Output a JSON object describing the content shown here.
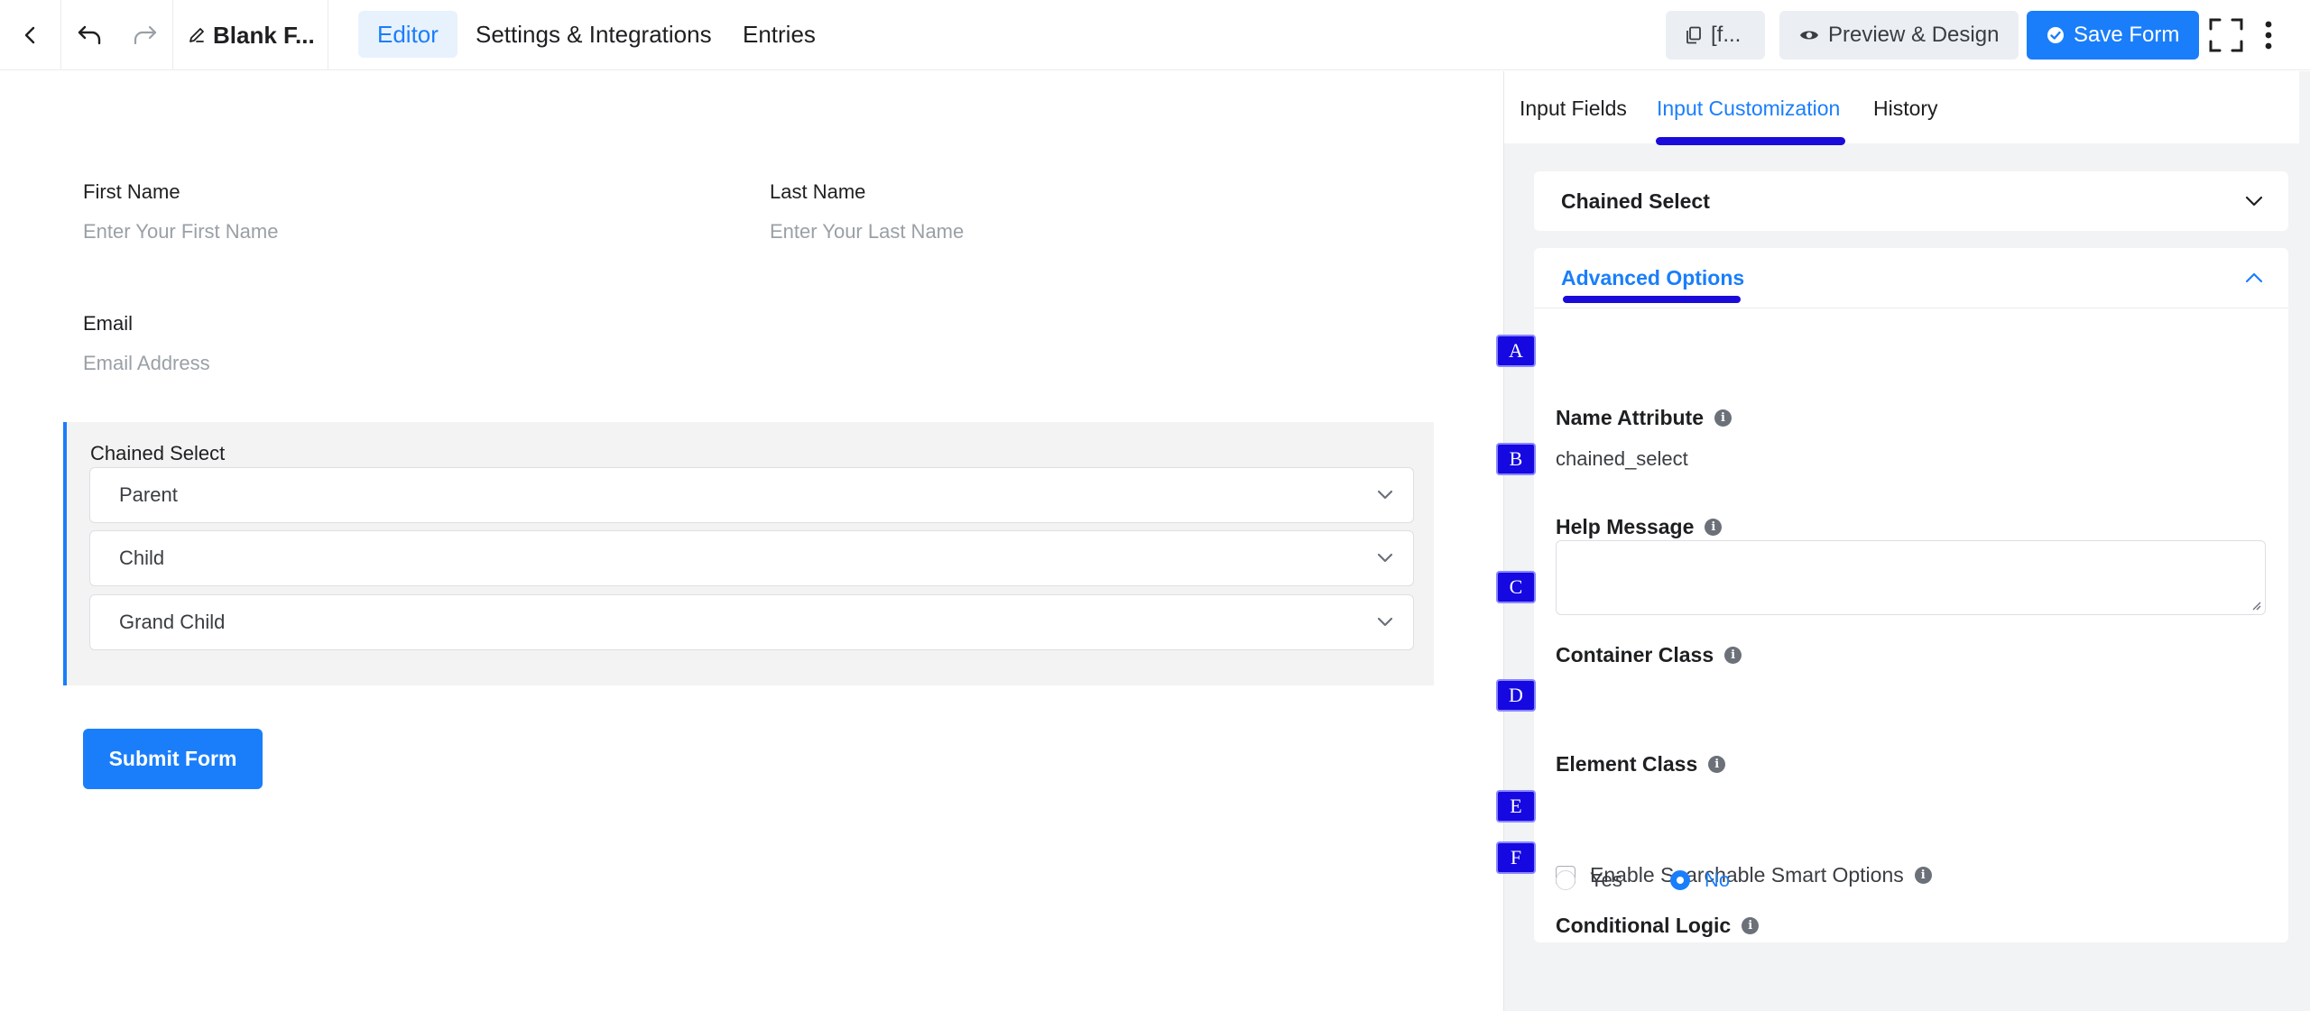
{
  "topbar": {
    "title": "Blank F...",
    "tabs": [
      "Editor",
      "Settings & Integrations",
      "Entries"
    ],
    "shortcode_label": "[f...",
    "preview_label": "Preview & Design",
    "save_label": "Save Form"
  },
  "form": {
    "first_name_label": "First Name",
    "first_name_placeholder": "Enter Your First Name",
    "last_name_label": "Last Name",
    "last_name_placeholder": "Enter Your Last Name",
    "email_label": "Email",
    "email_placeholder": "Email Address",
    "chained_label": "Chained Select",
    "selects": [
      "Parent",
      "Child",
      "Grand Child"
    ],
    "submit_label": "Submit Form"
  },
  "panel": {
    "tabs": [
      "Input Fields",
      "Input Customization",
      "History"
    ],
    "active_tab": "Input Customization",
    "section_title": "Chained Select",
    "advanced_title": "Advanced Options",
    "name_attribute_label": "Name Attribute",
    "name_attribute_value": "chained_select",
    "help_message_label": "Help Message",
    "container_class_label": "Container Class",
    "element_class_label": "Element Class",
    "searchable_label": "Enable Searchable Smart Options",
    "conditional_label": "Conditional Logic",
    "conditional_options": [
      "Yes",
      "No"
    ],
    "conditional_selected": "No",
    "markers": [
      "A",
      "B",
      "C",
      "D",
      "E",
      "F"
    ]
  },
  "colors": {
    "accent": "#1a7efb",
    "marker": "#1508e0"
  }
}
